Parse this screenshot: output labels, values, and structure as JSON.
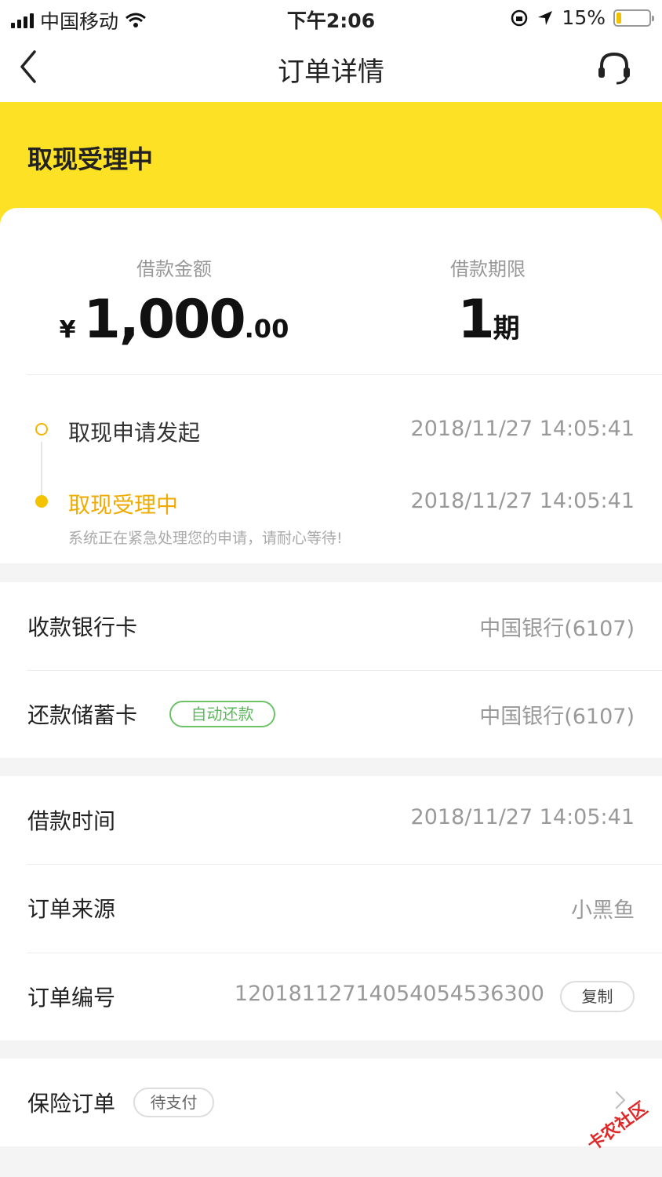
{
  "status_bar": {
    "carrier": "中国移动",
    "time": "下午2:06",
    "battery": "15%",
    "battery_level": 0.15
  },
  "nav": {
    "title": "订单详情"
  },
  "banner": {
    "status": "取现受理中"
  },
  "summary": {
    "amount_label": "借款金额",
    "amount_currency": "¥",
    "amount_integer": "1,000",
    "amount_decimal": ".00",
    "term_label": "借款期限",
    "term_value": "1",
    "term_unit": "期"
  },
  "timeline": [
    {
      "title": "取现申请发起",
      "time": "2018/11/27 14:05:41"
    },
    {
      "title": "取现受理中",
      "time": "2018/11/27 14:05:41",
      "note": "系统正在紧急处理您的申请，请耐心等待!"
    }
  ],
  "bank": {
    "receive_label": "收款银行卡",
    "receive_value": "中国银行(6107)",
    "repay_label": "还款储蓄卡",
    "repay_tag": "自动还款",
    "repay_value": "中国银行(6107)"
  },
  "order": {
    "time_label": "借款时间",
    "time_value": "2018/11/27 14:05:41",
    "source_label": "订单来源",
    "source_value": "小黑鱼",
    "number_label": "订单编号",
    "number_value": "120181127140540545363​00",
    "copy_label": "复制"
  },
  "insurance": {
    "label": "保险订单",
    "tag": "待支付"
  },
  "watermark": {
    "text": "卡农社区"
  },
  "colors": {
    "accent_yellow": "#fde124",
    "timeline_active": "#f5b400",
    "tag_green": "#5cb85c"
  }
}
